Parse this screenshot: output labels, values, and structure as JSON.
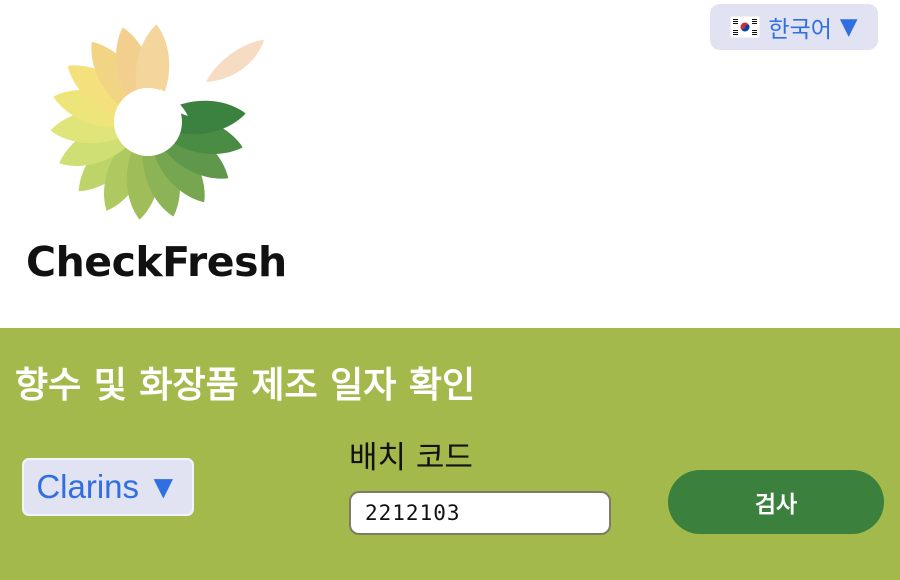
{
  "logo": {
    "text": "CheckFresh",
    "icon": "sunflower-petals-logo"
  },
  "language_selector": {
    "flag_icon": "south-korea-flag-icon",
    "label": "한국어",
    "arrow": "▼",
    "color": "#2f6fe0"
  },
  "panel": {
    "background": "#a3b94c",
    "title": "향수 및 화장품 제조 일자 확인",
    "brand_select": {
      "value": "Clarins",
      "arrow": "▼"
    },
    "batch_code": {
      "label": "배치 코드",
      "value": "2212103"
    },
    "check_button": {
      "label": "검사",
      "color": "#3b803c"
    }
  }
}
